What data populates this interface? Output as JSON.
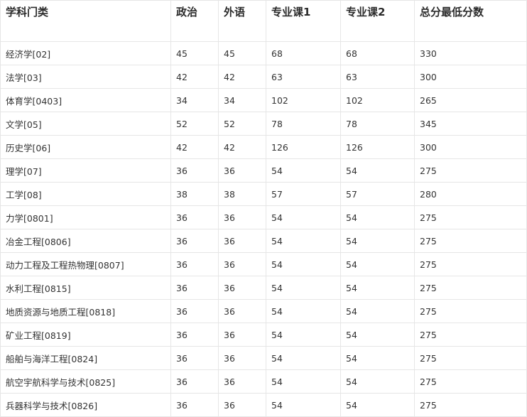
{
  "table": {
    "headers": [
      "学科门类",
      "政治",
      "外语",
      "专业课1",
      "专业课2",
      "总分最低分数"
    ],
    "rows": [
      [
        "经济学[02]",
        "45",
        "45",
        "68",
        "68",
        "330"
      ],
      [
        "法学[03]",
        "42",
        "42",
        "63",
        "63",
        "300"
      ],
      [
        "体育学[0403]",
        "34",
        "34",
        "102",
        "102",
        "265"
      ],
      [
        "文学[05]",
        "52",
        "52",
        "78",
        "78",
        "345"
      ],
      [
        "历史学[06]",
        "42",
        "42",
        "126",
        "126",
        "300"
      ],
      [
        "理学[07]",
        "36",
        "36",
        "54",
        "54",
        "275"
      ],
      [
        "工学[08]",
        "38",
        "38",
        "57",
        "57",
        "280"
      ],
      [
        "力学[0801]",
        "36",
        "36",
        "54",
        "54",
        "275"
      ],
      [
        "冶金工程[0806]",
        "36",
        "36",
        "54",
        "54",
        "275"
      ],
      [
        "动力工程及工程热物理[0807]",
        "36",
        "36",
        "54",
        "54",
        "275"
      ],
      [
        "水利工程[0815]",
        "36",
        "36",
        "54",
        "54",
        "275"
      ],
      [
        "地质资源与地质工程[0818]",
        "36",
        "36",
        "54",
        "54",
        "275"
      ],
      [
        "矿业工程[0819]",
        "36",
        "36",
        "54",
        "54",
        "275"
      ],
      [
        "船舶与海洋工程[0824]",
        "36",
        "36",
        "54",
        "54",
        "275"
      ],
      [
        "航空宇航科学与技术[0825]",
        "36",
        "36",
        "54",
        "54",
        "275"
      ],
      [
        "兵器科学与技术[0826]",
        "36",
        "36",
        "54",
        "54",
        "275"
      ]
    ]
  }
}
